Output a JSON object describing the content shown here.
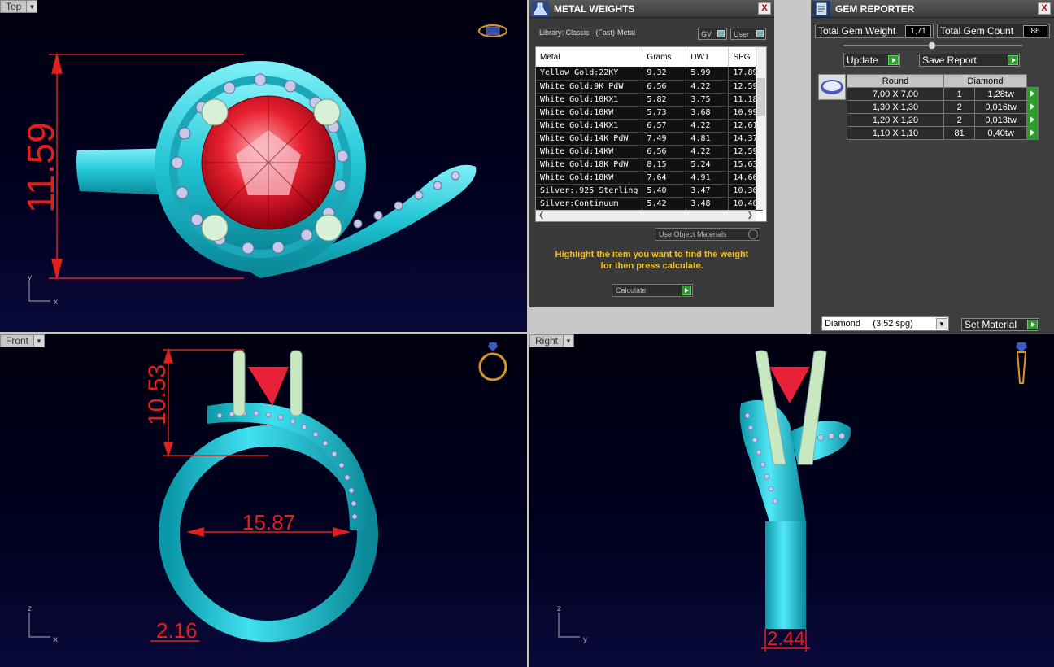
{
  "viewports": {
    "top": {
      "label": "Top",
      "dim": "11.59",
      "axis_v": "y",
      "axis_h": "x"
    },
    "front": {
      "label": "Front",
      "dim_height": "10.53",
      "dim_diameter": "15.87",
      "dim_width": "2.16",
      "axis_v": "z",
      "axis_h": "x"
    },
    "right": {
      "label": "Right",
      "dim_width": "2.44",
      "axis_v": "z",
      "axis_h": "y"
    }
  },
  "metal_weights": {
    "title": "METAL WEIGHTS",
    "close": "X",
    "library": "Library: Classic - (Fast)-Metal",
    "toggle_gv": "GV",
    "toggle_user": "User",
    "columns": [
      "Metal",
      "Grams",
      "DWT",
      "SPG"
    ],
    "rows": [
      {
        "metal": "Yellow Gold:22KY",
        "grams": "9.32",
        "dwt": "5.99",
        "spg": "17.89"
      },
      {
        "metal": "White Gold:9K PdW",
        "grams": "6.56",
        "dwt": "4.22",
        "spg": "12.59"
      },
      {
        "metal": "White Gold:10KX1",
        "grams": "5.82",
        "dwt": "3.75",
        "spg": "11.18"
      },
      {
        "metal": "White Gold:10KW",
        "grams": "5.73",
        "dwt": "3.68",
        "spg": "10.99"
      },
      {
        "metal": "White Gold:14KX1",
        "grams": "6.57",
        "dwt": "4.22",
        "spg": "12.61"
      },
      {
        "metal": "White Gold:14K PdW",
        "grams": "7.49",
        "dwt": "4.81",
        "spg": "14.37"
      },
      {
        "metal": "White Gold:14KW",
        "grams": "6.56",
        "dwt": "4.22",
        "spg": "12.59"
      },
      {
        "metal": "White Gold:18K PdW",
        "grams": "8.15",
        "dwt": "5.24",
        "spg": "15.63"
      },
      {
        "metal": "White Gold:18KW",
        "grams": "7.64",
        "dwt": "4.91",
        "spg": "14.66"
      },
      {
        "metal": "Silver:.925 Sterling",
        "grams": "5.40",
        "dwt": "3.47",
        "spg": "10.36"
      },
      {
        "metal": "Silver:Continuum",
        "grams": "5.42",
        "dwt": "3.48",
        "spg": "10.40"
      }
    ],
    "use_object_materials": "Use Object Materials",
    "hint_line1": "Highlight the item you want to find the weight",
    "hint_line2": "for then press calculate.",
    "calculate": "Calculate"
  },
  "gem_reporter": {
    "title": "GEM REPORTER",
    "close": "X",
    "total_weight_label": "Total Gem Weight",
    "total_weight_value": "1,71",
    "total_count_label": "Total Gem Count",
    "total_count_value": "86",
    "update": "Update",
    "save_report": "Save Report",
    "col_shape": "Round",
    "col_material": "Diamond",
    "rows": [
      {
        "size": "7,00 X 7,00",
        "count": "1",
        "weight": "1,28tw"
      },
      {
        "size": "1,30 X 1,30",
        "count": "2",
        "weight": "0,016tw"
      },
      {
        "size": "1,20 X 1,20",
        "count": "2",
        "weight": "0,013tw"
      },
      {
        "size": "1,10 X 1,10",
        "count": "81",
        "weight": "0,40tw"
      }
    ],
    "material_select": "Diamond     (3,52 spg)",
    "set_material": "Set Material"
  },
  "colors": {
    "metal": "#1ec8d8",
    "stone": "#e0202a",
    "dimension": "#e0201c",
    "hint": "#f0c020"
  }
}
